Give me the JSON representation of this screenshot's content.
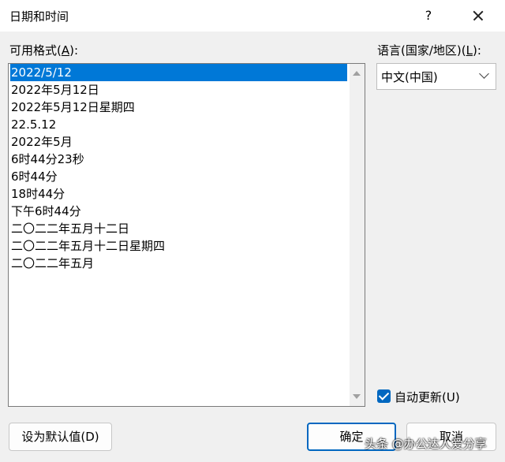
{
  "window": {
    "title": "日期和时间",
    "help_label": "?",
    "close_label": "×"
  },
  "formats": {
    "label_text": "可用格式(",
    "label_key": "A",
    "label_end": "):",
    "items": [
      "2022/5/12",
      "2022年5月12日",
      "2022年5月12日星期四",
      "22.5.12",
      "2022年5月",
      "6时44分23秒",
      "6时44分",
      "18时44分",
      "下午6时44分",
      "二〇二二年五月十二日",
      "二〇二二年五月十二日星期四",
      "二〇二二年五月"
    ],
    "selected_index": 0
  },
  "language": {
    "label_text": "语言(国家/地区)(",
    "label_key": "L",
    "label_end": "):",
    "value": "中文(中国)"
  },
  "auto_update": {
    "checked": true,
    "label": "自动更新(U)"
  },
  "buttons": {
    "set_default": "设为默认值(D)",
    "ok": "确定",
    "cancel": "取消"
  },
  "watermark": "头条 @办公达人爱分享"
}
